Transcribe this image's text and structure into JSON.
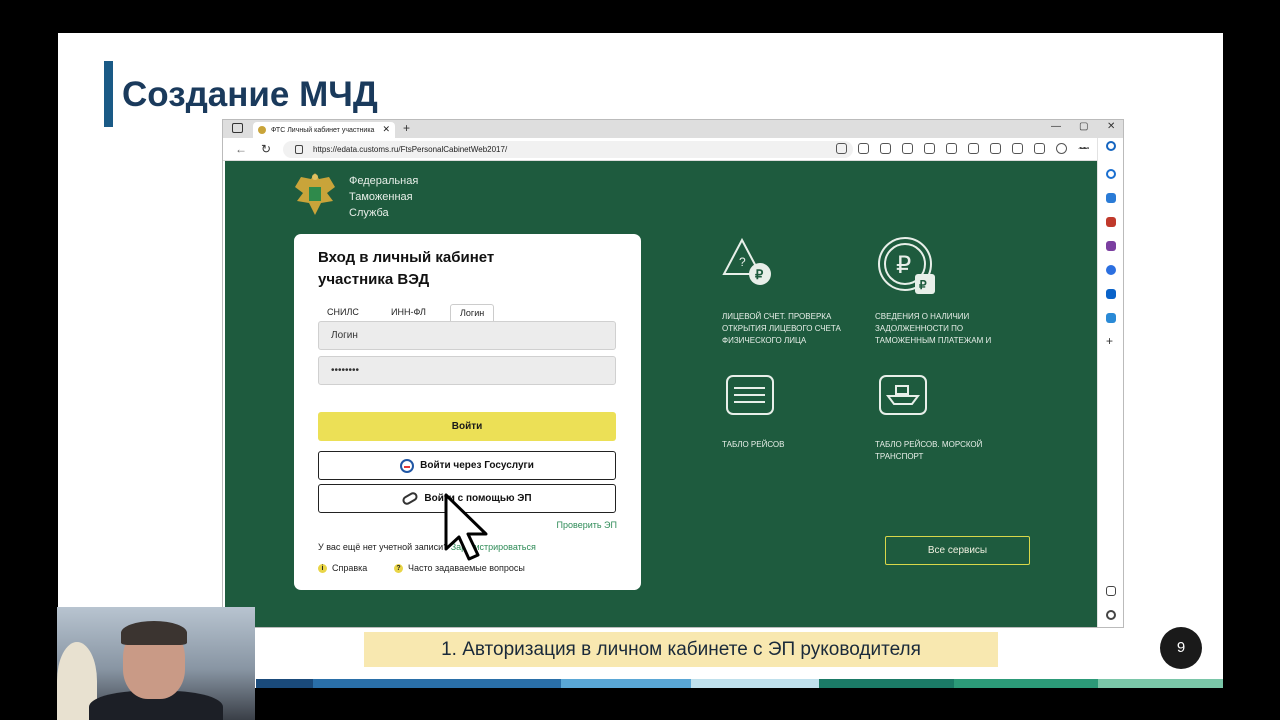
{
  "slide": {
    "title": "Создание МЧД",
    "caption": "1. Авторизация в личном кабинете с ЭП руководителя",
    "page_number": "9"
  },
  "browser": {
    "tab_title": "ФТС Личный кабинет участника",
    "tab_close": "✕",
    "new_tab": "+",
    "url": "https://edata.customs.ru/FtsPersonalCabinetWeb2017/",
    "win_min": "—",
    "win_max": "▢",
    "win_close": "✕",
    "nav_back": "←",
    "nav_reload": "↻"
  },
  "site": {
    "org_name_line1": "Федеральная",
    "org_name_line2": "Таможенная",
    "org_name_line3": "Служба",
    "login_card": {
      "heading_line1": "Вход в личный кабинет",
      "heading_line2": "участника ВЭД",
      "tabs": [
        "СНИЛС",
        "ИНН-ФЛ",
        "Логин"
      ],
      "login_placeholder": "Логин",
      "password_value": "••••••••",
      "submit_label": "Войти",
      "gosuslugi_label": "Войти через Госуслуги",
      "ep_label": "Войти с помощью ЭП",
      "check_ep": "Проверить ЭП",
      "no_account": "У вас ещё нет учетной записи?",
      "register": "Зарегистрироваться",
      "help": "Справка",
      "faq": "Часто задаваемые вопросы",
      "help_icon": "i",
      "faq_icon": "?"
    },
    "services": [
      {
        "label": "ЛИЦЕВОЙ СЧЕТ. ПРОВЕРКА ОТКРЫТИЯ ЛИЦЕВОГО СЧЕТА ФИЗИЧЕСКОГО ЛИЦА",
        "icon": "warning-ruble-icon"
      },
      {
        "label": "СВЕДЕНИЯ О НАЛИЧИИ ЗАДОЛЖЕННОСТИ ПО ТАМОЖЕННЫМ ПЛАТЕЖАМ И",
        "icon": "ruble-coin-icon"
      },
      {
        "label": "ТАБЛО РЕЙСОВ",
        "icon": "flight-board-icon"
      },
      {
        "label": "ТАБЛО РЕЙСОВ. МОРСКОЙ ТРАНСПОРТ",
        "icon": "ship-board-icon"
      }
    ],
    "all_services": "Все сервисы"
  },
  "colors": {
    "page_green": "#1e5b3e",
    "login_button": "#ece056",
    "accent_green": "#2e8b57",
    "title_blue": "#1a3a5c"
  }
}
